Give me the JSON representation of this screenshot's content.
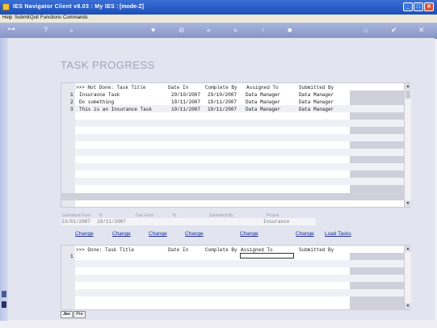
{
  "window": {
    "title": "IES Navigator Client v8.03 : My IES :",
    "mode": "[mode-Z]",
    "buttons": {
      "minimize": "_",
      "maximize": "□",
      "close": "✕"
    }
  },
  "menu": {
    "items": [
      "Help",
      "Submit",
      "Quit",
      "Functions",
      "Commands"
    ]
  },
  "toolbar": {
    "icons": {
      "key": "⊶",
      "help": "?",
      "search": "⌕",
      "heart": "♥",
      "link": "⊘",
      "first": "«",
      "next": "»",
      "up": "↑",
      "stop": "■",
      "home": "⌂",
      "ok": "✔",
      "close": "✕"
    }
  },
  "page": {
    "title": "TASK PROGRESS"
  },
  "not_done": {
    "headers": [
      ">>> Not Done: Task Title",
      "Date In",
      "Complete By",
      "Assigned To",
      "Submitted By"
    ],
    "rows": [
      {
        "num": "1",
        "title": "Insurance Task",
        "date_in": "29/10/2007",
        "complete_by": "29/10/2007",
        "assigned_to": "Data Manager",
        "submitted_by": "Data Manager"
      },
      {
        "num": "2",
        "title": "Do something",
        "date_in": "19/11/2007",
        "complete_by": "19/11/2007",
        "assigned_to": "Data Manager",
        "submitted_by": "Data Manager"
      },
      {
        "num": "3",
        "title": "This is an Insurance Task",
        "date_in": "19/11/2007",
        "complete_by": "19/11/2007",
        "assigned_to": "Data Manager",
        "submitted_by": "Data Manager"
      }
    ],
    "scroll_up": "▲",
    "scroll_down": "▼"
  },
  "filters": {
    "labels": {
      "submitted_from": "Submitted From",
      "to1": "To",
      "due_from": "Due From",
      "to2": "To",
      "submitted_by": "Submitted By",
      "project": "Project"
    },
    "values": {
      "submitted_from": "23/01/2007",
      "to1": "19/11/2007",
      "project": "Insurance"
    }
  },
  "actions": {
    "change_labels": [
      "Change",
      "Change",
      "Change",
      "Change",
      "Change",
      "Change"
    ],
    "load_tasks": "Load Tasks"
  },
  "done": {
    "headers": [
      ">>> Done: Task Title",
      "Date In",
      "Complete By",
      "Assigned To",
      "Submitted By"
    ],
    "rows": [
      {
        "num": "1"
      }
    ],
    "scroll_up": "▲",
    "scroll_down": "▼"
  },
  "tabs": [
    "Jec",
    "Pre"
  ]
}
